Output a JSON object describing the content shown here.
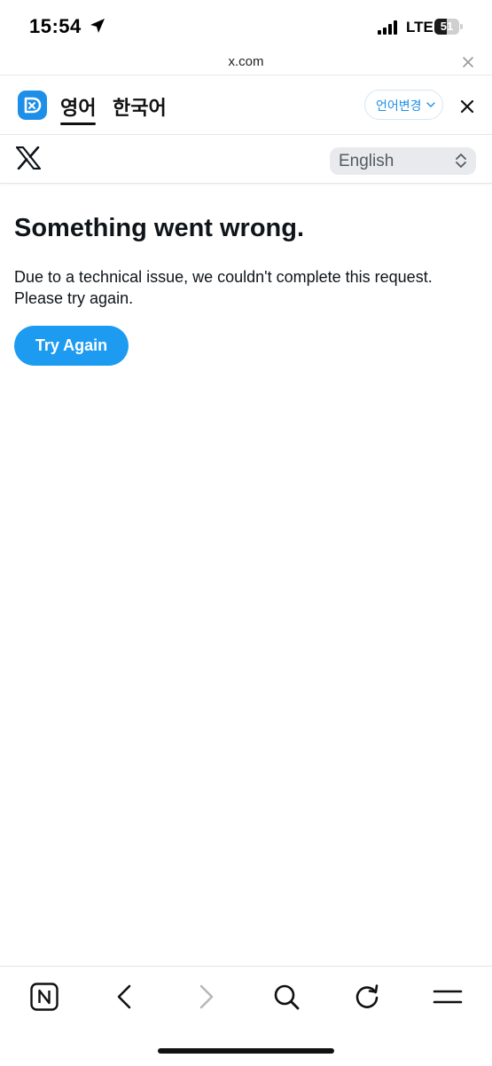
{
  "status_bar": {
    "time": "15:54",
    "network": "LTE",
    "battery_text": "51",
    "battery_level": 0.51,
    "icons": [
      "location-arrow-icon",
      "signal-bars-icon",
      "battery-icon"
    ]
  },
  "browser": {
    "url": "x.com",
    "close_icon": "close-icon"
  },
  "translate_bar": {
    "icon": "papago-icon",
    "tabs": [
      {
        "label": "영어",
        "active": true
      },
      {
        "label": "한국어",
        "active": false
      }
    ],
    "change_language_label": "언어변경",
    "close_icon": "close-icon",
    "accent_color": "#1e8fe8"
  },
  "header": {
    "logo": "x-logo",
    "language_select": {
      "selected": "English"
    }
  },
  "main": {
    "title": "Something went wrong.",
    "message": "Due to a technical issue, we couldn't complete this request. Please try again.",
    "button_label": "Try Again",
    "button_color": "#1d9bf0"
  },
  "toolbar": {
    "items": [
      "naver-home-icon",
      "back-arrow-icon",
      "forward-arrow-icon",
      "search-icon",
      "refresh-icon",
      "menu-icon"
    ]
  }
}
